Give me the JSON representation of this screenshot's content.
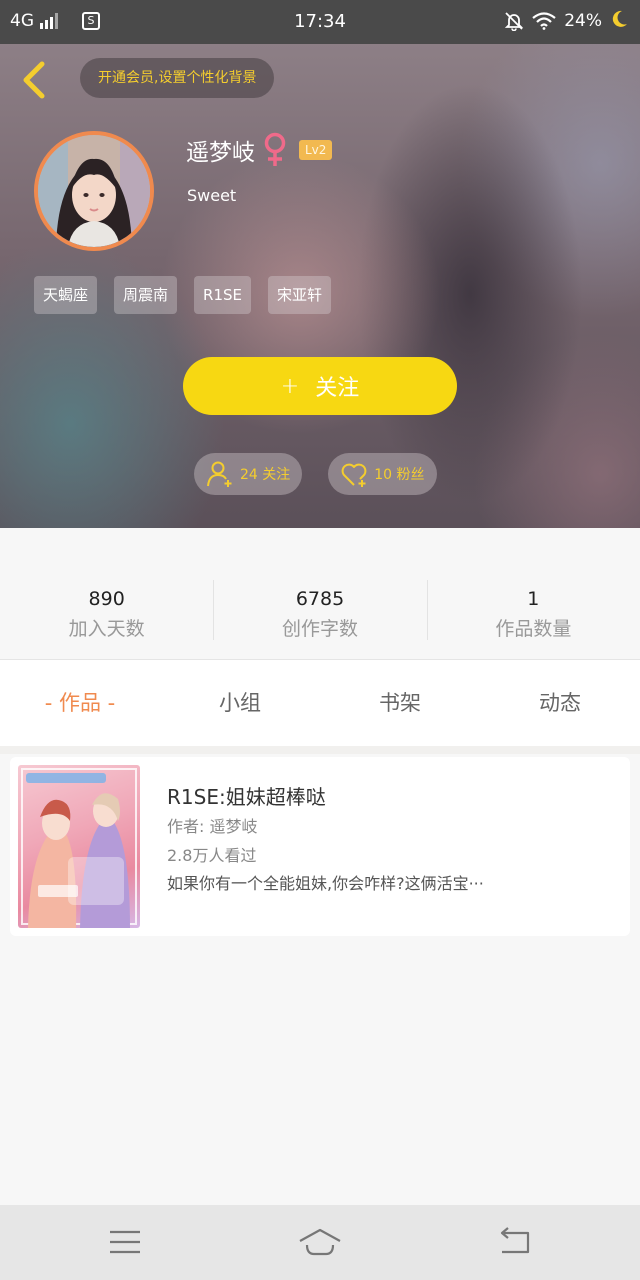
{
  "status_bar": {
    "network": "4G",
    "sim_label": "S",
    "time": "17:34",
    "battery": "24%"
  },
  "header": {
    "vip_prompt": "开通会员,设置个性化背景",
    "username": "遥梦岐",
    "level": "Lv2",
    "signature": "Sweet",
    "tags": [
      "天蝎座",
      "周震南",
      "R1SE",
      "宋亚轩"
    ],
    "follow_button": {
      "plus": "+",
      "label": "关注"
    },
    "following": "24 关注",
    "fans": "10 粉丝"
  },
  "stats": [
    {
      "value": "890",
      "label": "加入天数"
    },
    {
      "value": "6785",
      "label": "创作字数"
    },
    {
      "value": "1",
      "label": "作品数量"
    }
  ],
  "tabs": [
    {
      "label": "- 作品 -",
      "active": true
    },
    {
      "label": "小组",
      "active": false
    },
    {
      "label": "书架",
      "active": false
    },
    {
      "label": "动态",
      "active": false
    }
  ],
  "works": [
    {
      "title": "R1SE:姐妹超棒哒",
      "author": "作者: 遥梦岐",
      "views": "2.8万人看过",
      "description": "如果你有一个全能姐妹,你会咋样?这俩活宝···"
    }
  ],
  "colors": {
    "accent_orange": "#f08a4e",
    "follow_yellow": "#f7d812",
    "vip_gold": "#f4cd2e"
  },
  "icons": {
    "back": "chevron-left-icon",
    "gender": "female-icon",
    "following": "add-person-icon",
    "fans": "heart-plus-icon",
    "nav": [
      "menu-icon",
      "home-icon",
      "back-arrow-icon"
    ]
  }
}
